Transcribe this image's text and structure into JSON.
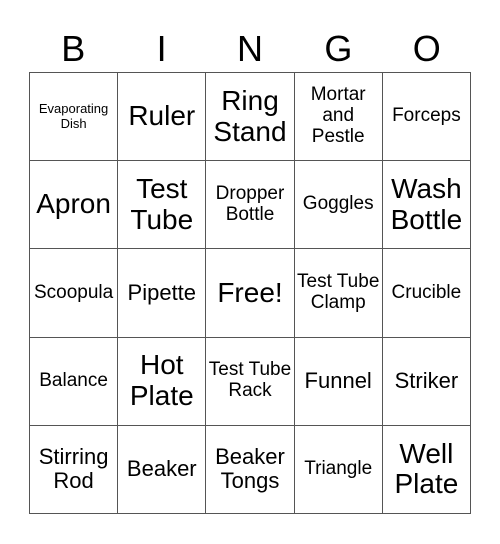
{
  "header": [
    "B",
    "I",
    "N",
    "G",
    "O"
  ],
  "cells": [
    {
      "text": "Evaporating Dish",
      "size": "s1"
    },
    {
      "text": "Ruler",
      "size": "s4"
    },
    {
      "text": "Ring Stand",
      "size": "s4"
    },
    {
      "text": "Mortar and Pestle",
      "size": "s2"
    },
    {
      "text": "Forceps",
      "size": "s2"
    },
    {
      "text": "Apron",
      "size": "s4"
    },
    {
      "text": "Test Tube",
      "size": "s4"
    },
    {
      "text": "Dropper Bottle",
      "size": "s2"
    },
    {
      "text": "Goggles",
      "size": "s2"
    },
    {
      "text": "Wash Bottle",
      "size": "s4"
    },
    {
      "text": "Scoopula",
      "size": "s2"
    },
    {
      "text": "Pipette",
      "size": "s3"
    },
    {
      "text": "Free!",
      "size": "s4"
    },
    {
      "text": "Test Tube Clamp",
      "size": "s2"
    },
    {
      "text": "Crucible",
      "size": "s2"
    },
    {
      "text": "Balance",
      "size": "s2"
    },
    {
      "text": "Hot Plate",
      "size": "s4"
    },
    {
      "text": "Test Tube Rack",
      "size": "s2"
    },
    {
      "text": "Funnel",
      "size": "s3"
    },
    {
      "text": "Striker",
      "size": "s3"
    },
    {
      "text": "Stirring Rod",
      "size": "s3"
    },
    {
      "text": "Beaker",
      "size": "s3"
    },
    {
      "text": "Beaker Tongs",
      "size": "s3"
    },
    {
      "text": "Triangle",
      "size": "s2"
    },
    {
      "text": "Well Plate",
      "size": "s4"
    }
  ]
}
